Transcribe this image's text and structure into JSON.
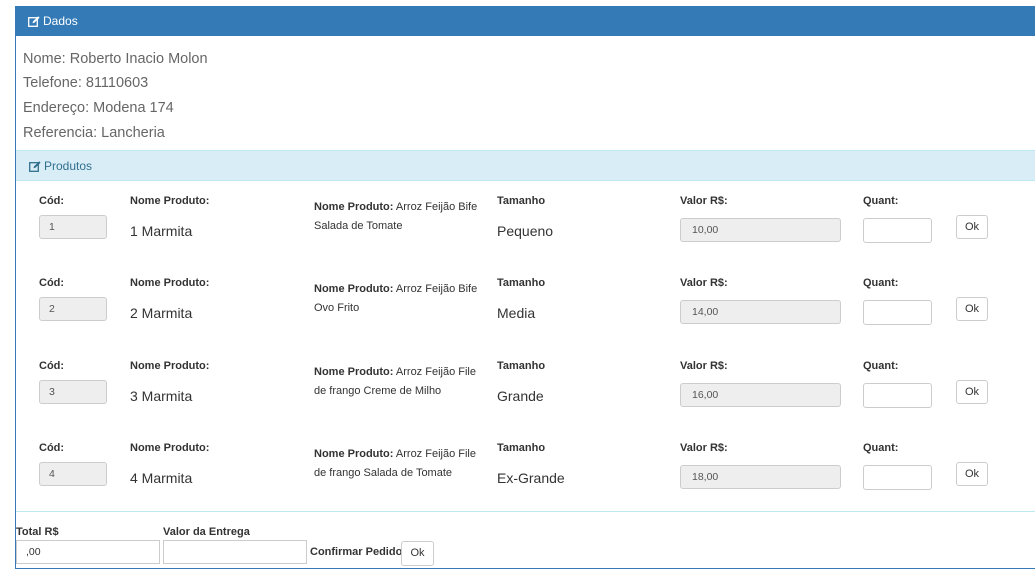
{
  "dados": {
    "title": "Dados",
    "icon": "edit-icon",
    "nome": "Nome: Roberto Inacio Molon",
    "telefone": "Telefone: 81110603",
    "endereco": "Endereço: Modena 174",
    "referencia": "Referencia: Lancheria"
  },
  "produtos": {
    "title": "Produtos",
    "icon": "edit-icon",
    "labels": {
      "cod": "Cód:",
      "nome": "Nome Produto:",
      "desc_prefix": "Nome Produto:",
      "tamanho": "Tamanho",
      "valor": "Valor R$:",
      "quant": "Quant:",
      "ok": "Ok"
    },
    "items": [
      {
        "cod": "1",
        "nome": "1 Marmita",
        "desc": "Arroz Feijão Bife Salada de Tomate",
        "tamanho": "Pequeno",
        "valor": "10,00",
        "quant": ""
      },
      {
        "cod": "2",
        "nome": "2 Marmita",
        "desc": "Arroz Feijão Bife Ovo Frito",
        "tamanho": "Media",
        "valor": "14,00",
        "quant": ""
      },
      {
        "cod": "3",
        "nome": "3 Marmita",
        "desc": "Arroz Feijão File de frango Creme de Milho",
        "tamanho": "Grande",
        "valor": "16,00",
        "quant": ""
      },
      {
        "cod": "4",
        "nome": "4 Marmita",
        "desc": "Arroz Feijão File de frango Salada de Tomate",
        "tamanho": "Ex-Grande",
        "valor": "18,00",
        "quant": ""
      }
    ]
  },
  "footer": {
    "total_label": "Total R$",
    "total_value": ",00",
    "entrega_label": "Valor da Entrega",
    "entrega_value": "",
    "confirm_label": "Confirmar Pedido",
    "confirm_button": "Ok"
  },
  "colors": {
    "primary": "#337ab7",
    "info_bg": "#d9edf7",
    "info_text": "#31708f",
    "readonly_bg": "#eeeeee"
  }
}
